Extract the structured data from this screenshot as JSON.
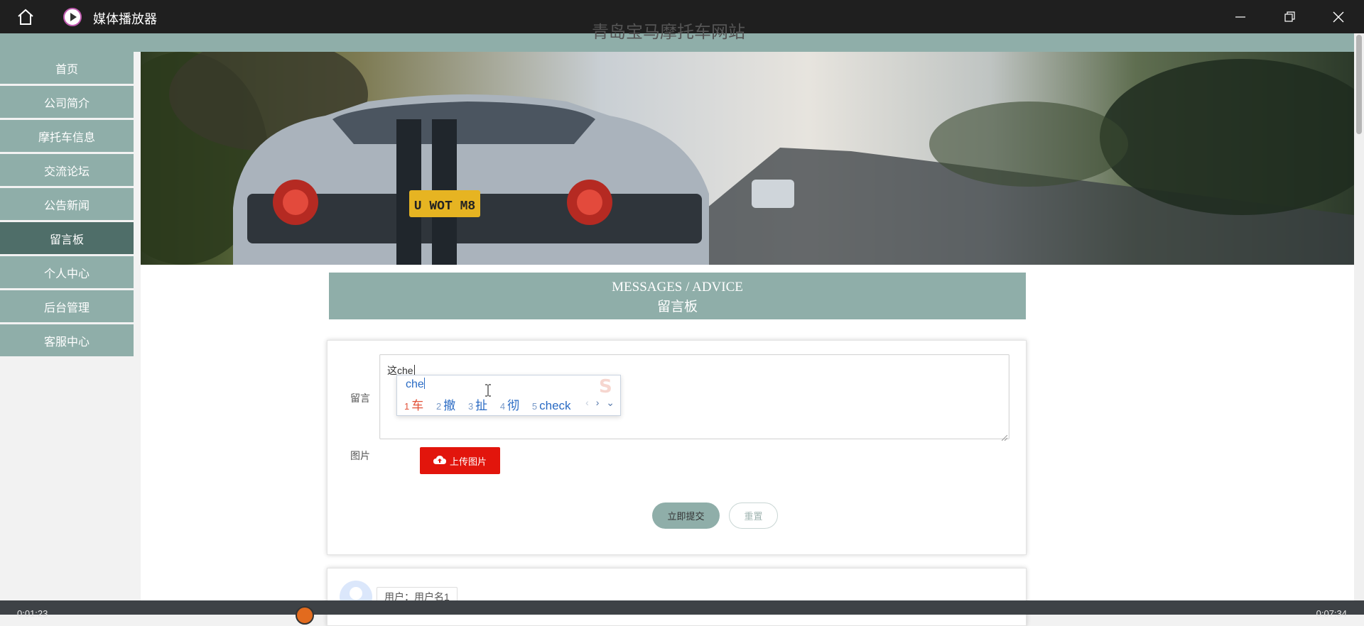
{
  "player": {
    "app_title": "媒体播放器",
    "time_elapsed": "0:01:23",
    "time_total": "0:07:34"
  },
  "site": {
    "title": "青岛宝马摩托车网站"
  },
  "sidebar": {
    "items": [
      {
        "label": "首页"
      },
      {
        "label": "公司简介"
      },
      {
        "label": "摩托车信息"
      },
      {
        "label": "交流论坛"
      },
      {
        "label": "公告新闻"
      },
      {
        "label": "留言板",
        "active": true
      },
      {
        "label": "个人中心"
      },
      {
        "label": "后台管理"
      },
      {
        "label": "客服中心"
      }
    ]
  },
  "hero": {
    "license_plate": "U WOT M8"
  },
  "section": {
    "title_en": "MESSAGES / ADVICE",
    "title_cn": "留言板"
  },
  "form": {
    "message_label": "留言",
    "message_value": "这che",
    "image_label": "图片",
    "upload_label": "上传图片",
    "submit_label": "立即提交",
    "reset_label": "重置"
  },
  "ime": {
    "composition": "che",
    "candidates": [
      {
        "num": "1",
        "text": "车"
      },
      {
        "num": "2",
        "text": "撤"
      },
      {
        "num": "3",
        "text": "扯"
      },
      {
        "num": "4",
        "text": "彻"
      },
      {
        "num": "5",
        "text": "check"
      }
    ],
    "prev": "‹",
    "next": "›",
    "expand": "⌄"
  },
  "comments": [
    {
      "user_label": "用户：用户名1"
    }
  ],
  "colors": {
    "accent": "#8faea9",
    "accent_active": "#4f6e69",
    "upload_red": "#e2150c",
    "ime_blue": "#2a6bc4",
    "ime_first": "#e2533a"
  }
}
